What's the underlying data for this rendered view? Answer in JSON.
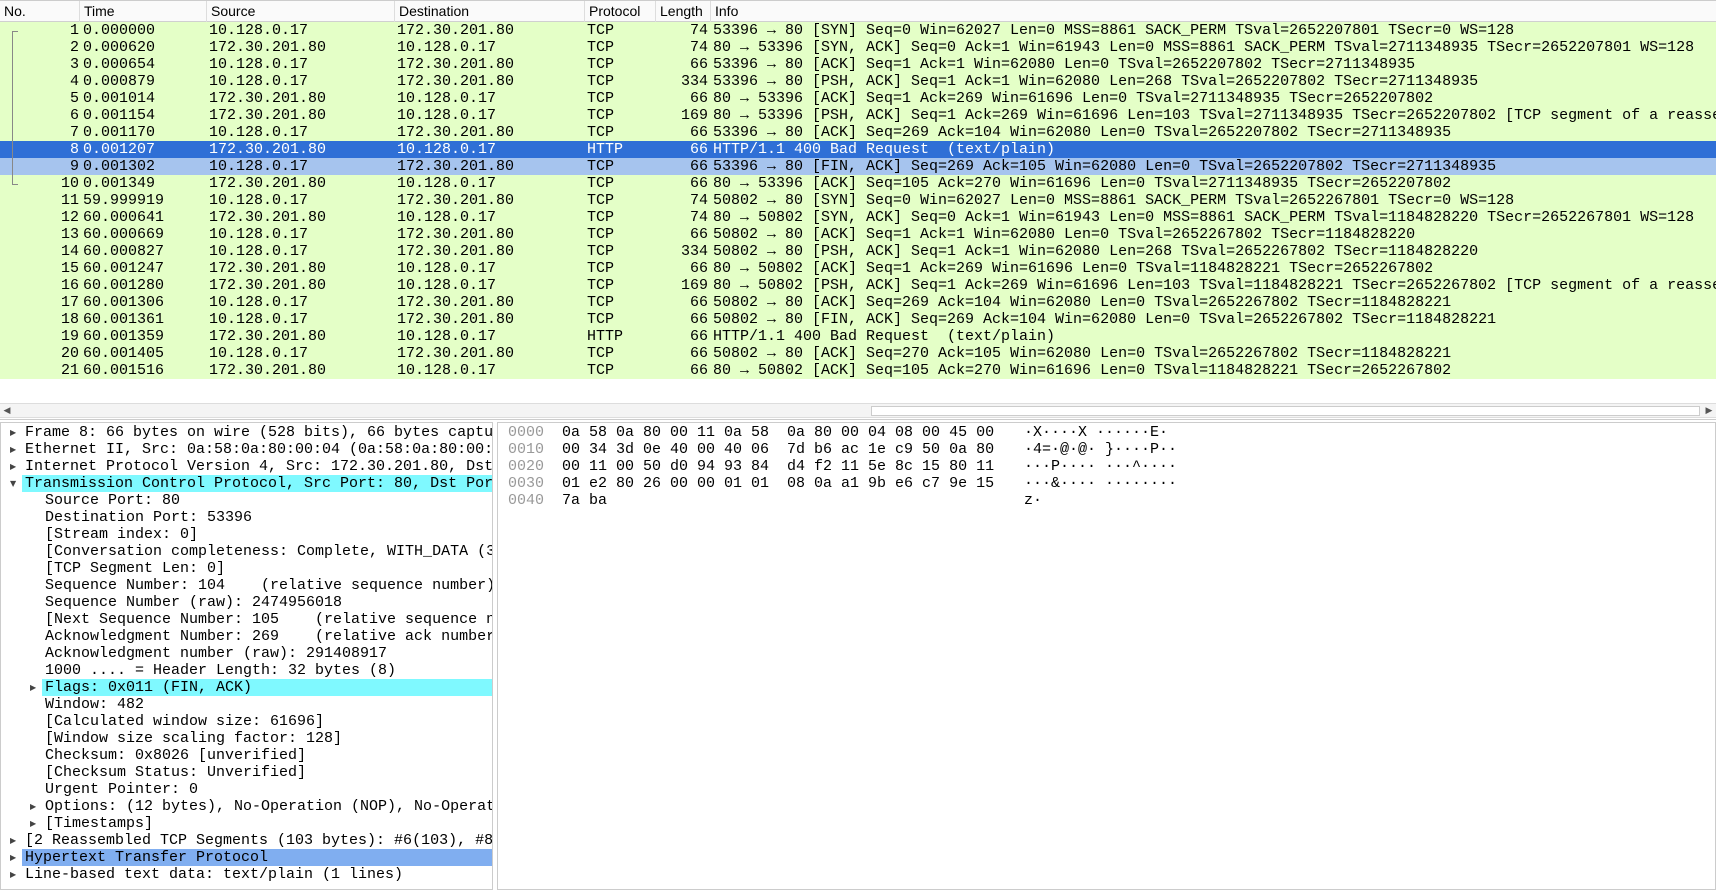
{
  "columns": {
    "no": "No.",
    "time": "Time",
    "source": "Source",
    "destination": "Destination",
    "protocol": "Protocol",
    "length": "Length",
    "info": "Info"
  },
  "packets": [
    {
      "no": "1",
      "time": "0.000000",
      "src": "10.128.0.17",
      "dst": "172.30.201.80",
      "proto": "TCP",
      "len": "74",
      "info": "53396 → 80 [SYN] Seq=0 Win=62027 Len=0 MSS=8861 SACK_PERM TSval=2652207801 TSecr=0 WS=128"
    },
    {
      "no": "2",
      "time": "0.000620",
      "src": "172.30.201.80",
      "dst": "10.128.0.17",
      "proto": "TCP",
      "len": "74",
      "info": "80 → 53396 [SYN, ACK] Seq=0 Ack=1 Win=61943 Len=0 MSS=8861 SACK_PERM TSval=2711348935 TSecr=2652207801 WS=128"
    },
    {
      "no": "3",
      "time": "0.000654",
      "src": "10.128.0.17",
      "dst": "172.30.201.80",
      "proto": "TCP",
      "len": "66",
      "info": "53396 → 80 [ACK] Seq=1 Ack=1 Win=62080 Len=0 TSval=2652207802 TSecr=2711348935"
    },
    {
      "no": "4",
      "time": "0.000879",
      "src": "10.128.0.17",
      "dst": "172.30.201.80",
      "proto": "TCP",
      "len": "334",
      "info": "53396 → 80 [PSH, ACK] Seq=1 Ack=1 Win=62080 Len=268 TSval=2652207802 TSecr=2711348935"
    },
    {
      "no": "5",
      "time": "0.001014",
      "src": "172.30.201.80",
      "dst": "10.128.0.17",
      "proto": "TCP",
      "len": "66",
      "info": "80 → 53396 [ACK] Seq=1 Ack=269 Win=61696 Len=0 TSval=2711348935 TSecr=2652207802"
    },
    {
      "no": "6",
      "time": "0.001154",
      "src": "172.30.201.80",
      "dst": "10.128.0.17",
      "proto": "TCP",
      "len": "169",
      "info": "80 → 53396 [PSH, ACK] Seq=1 Ack=269 Win=61696 Len=103 TSval=2711348935 TSecr=2652207802 [TCP segment of a reasse"
    },
    {
      "no": "7",
      "time": "0.001170",
      "src": "10.128.0.17",
      "dst": "172.30.201.80",
      "proto": "TCP",
      "len": "66",
      "info": "53396 → 80 [ACK] Seq=269 Ack=104 Win=62080 Len=0 TSval=2652207802 TSecr=2711348935"
    },
    {
      "no": "8",
      "time": "0.001207",
      "src": "172.30.201.80",
      "dst": "10.128.0.17",
      "proto": "HTTP",
      "len": "66",
      "info": "HTTP/1.1 400 Bad Request  (text/plain)",
      "state": "selected"
    },
    {
      "no": "9",
      "time": "0.001302",
      "src": "10.128.0.17",
      "dst": "172.30.201.80",
      "proto": "TCP",
      "len": "66",
      "info": "53396 → 80 [FIN, ACK] Seq=269 Ack=105 Win=62080 Len=0 TSval=2652207802 TSecr=2711348935",
      "state": "related"
    },
    {
      "no": "10",
      "time": "0.001349",
      "src": "172.30.201.80",
      "dst": "10.128.0.17",
      "proto": "TCP",
      "len": "66",
      "info": "80 → 53396 [ACK] Seq=105 Ack=270 Win=61696 Len=0 TSval=2711348935 TSecr=2652207802"
    },
    {
      "no": "11",
      "time": "59.999919",
      "src": "10.128.0.17",
      "dst": "172.30.201.80",
      "proto": "TCP",
      "len": "74",
      "info": "50802 → 80 [SYN] Seq=0 Win=62027 Len=0 MSS=8861 SACK_PERM TSval=2652267801 TSecr=0 WS=128"
    },
    {
      "no": "12",
      "time": "60.000641",
      "src": "172.30.201.80",
      "dst": "10.128.0.17",
      "proto": "TCP",
      "len": "74",
      "info": "80 → 50802 [SYN, ACK] Seq=0 Ack=1 Win=61943 Len=0 MSS=8861 SACK_PERM TSval=1184828220 TSecr=2652267801 WS=128"
    },
    {
      "no": "13",
      "time": "60.000669",
      "src": "10.128.0.17",
      "dst": "172.30.201.80",
      "proto": "TCP",
      "len": "66",
      "info": "50802 → 80 [ACK] Seq=1 Ack=1 Win=62080 Len=0 TSval=2652267802 TSecr=1184828220"
    },
    {
      "no": "14",
      "time": "60.000827",
      "src": "10.128.0.17",
      "dst": "172.30.201.80",
      "proto": "TCP",
      "len": "334",
      "info": "50802 → 80 [PSH, ACK] Seq=1 Ack=1 Win=62080 Len=268 TSval=2652267802 TSecr=1184828220"
    },
    {
      "no": "15",
      "time": "60.001247",
      "src": "172.30.201.80",
      "dst": "10.128.0.17",
      "proto": "TCP",
      "len": "66",
      "info": "80 → 50802 [ACK] Seq=1 Ack=269 Win=61696 Len=0 TSval=1184828221 TSecr=2652267802"
    },
    {
      "no": "16",
      "time": "60.001280",
      "src": "172.30.201.80",
      "dst": "10.128.0.17",
      "proto": "TCP",
      "len": "169",
      "info": "80 → 50802 [PSH, ACK] Seq=1 Ack=269 Win=61696 Len=103 TSval=1184828221 TSecr=2652267802 [TCP segment of a reasse"
    },
    {
      "no": "17",
      "time": "60.001306",
      "src": "10.128.0.17",
      "dst": "172.30.201.80",
      "proto": "TCP",
      "len": "66",
      "info": "50802 → 80 [ACK] Seq=269 Ack=104 Win=62080 Len=0 TSval=2652267802 TSecr=1184828221"
    },
    {
      "no": "18",
      "time": "60.001361",
      "src": "10.128.0.17",
      "dst": "172.30.201.80",
      "proto": "TCP",
      "len": "66",
      "info": "50802 → 80 [FIN, ACK] Seq=269 Ack=104 Win=62080 Len=0 TSval=2652267802 TSecr=1184828221"
    },
    {
      "no": "19",
      "time": "60.001359",
      "src": "172.30.201.80",
      "dst": "10.128.0.17",
      "proto": "HTTP",
      "len": "66",
      "info": "HTTP/1.1 400 Bad Request  (text/plain)"
    },
    {
      "no": "20",
      "time": "60.001405",
      "src": "10.128.0.17",
      "dst": "172.30.201.80",
      "proto": "TCP",
      "len": "66",
      "info": "50802 → 80 [ACK] Seq=270 Ack=105 Win=62080 Len=0 TSval=2652267802 TSecr=1184828221"
    },
    {
      "no": "21",
      "time": "60.001516",
      "src": "172.30.201.80",
      "dst": "10.128.0.17",
      "proto": "TCP",
      "len": "66",
      "info": "80 → 50802 [ACK] Seq=105 Ack=270 Win=61696 Len=0 TSval=1184828221 TSecr=2652267802"
    }
  ],
  "details": [
    {
      "text": "Frame 8: 66 bytes on wire (528 bits), 66 bytes captu",
      "level": 0,
      "arrow": "collapsed"
    },
    {
      "text": "Ethernet II, Src: 0a:58:0a:80:00:04 (0a:58:0a:80:00:",
      "level": 0,
      "arrow": "collapsed"
    },
    {
      "text": "Internet Protocol Version 4, Src: 172.30.201.80, Dst",
      "level": 0,
      "arrow": "collapsed"
    },
    {
      "text": "Transmission Control Protocol, Src Port: 80, Dst Por",
      "level": 0,
      "arrow": "expanded",
      "highlight": "cyan"
    },
    {
      "text": "Source Port: 80",
      "level": 1
    },
    {
      "text": "Destination Port: 53396",
      "level": 1
    },
    {
      "text": "[Stream index: 0]",
      "level": 1
    },
    {
      "text": "[Conversation completeness: Complete, WITH_DATA (3",
      "level": 1
    },
    {
      "text": "[TCP Segment Len: 0]",
      "level": 1
    },
    {
      "text": "Sequence Number: 104    (relative sequence number)",
      "level": 1
    },
    {
      "text": "Sequence Number (raw): 2474956018",
      "level": 1
    },
    {
      "text": "[Next Sequence Number: 105    (relative sequence n",
      "level": 1
    },
    {
      "text": "Acknowledgment Number: 269    (relative ack number",
      "level": 1
    },
    {
      "text": "Acknowledgment number (raw): 291408917",
      "level": 1
    },
    {
      "text": "1000 .... = Header Length: 32 bytes (8)",
      "level": 1
    },
    {
      "text": "Flags: 0x011 (FIN, ACK)",
      "level": 1,
      "arrow": "collapsed",
      "highlight": "cyan"
    },
    {
      "text": "Window: 482",
      "level": 1
    },
    {
      "text": "[Calculated window size: 61696]",
      "level": 1
    },
    {
      "text": "[Window size scaling factor: 128]",
      "level": 1
    },
    {
      "text": "Checksum: 0x8026 [unverified]",
      "level": 1
    },
    {
      "text": "[Checksum Status: Unverified]",
      "level": 1
    },
    {
      "text": "Urgent Pointer: 0",
      "level": 1
    },
    {
      "text": "Options: (12 bytes), No-Operation (NOP), No-Operat",
      "level": 1,
      "arrow": "collapsed"
    },
    {
      "text": "[Timestamps]",
      "level": 1,
      "arrow": "collapsed"
    },
    {
      "text": "[2 Reassembled TCP Segments (103 bytes): #6(103), #8",
      "level": 0,
      "arrow": "collapsed"
    },
    {
      "text": "Hypertext Transfer Protocol",
      "level": 0,
      "arrow": "collapsed",
      "highlight": "blue"
    },
    {
      "text": "Line-based text data: text/plain (1 lines)",
      "level": 0,
      "arrow": "collapsed"
    }
  ],
  "bytes": [
    {
      "offset": "0000",
      "hex": "0a 58 0a 80 00 11 0a 58  0a 80 00 04 08 00 45 00",
      "ascii": "·X····X ······E·"
    },
    {
      "offset": "0010",
      "hex": "00 34 3d 0e 40 00 40 06  7d b6 ac 1e c9 50 0a 80",
      "ascii": "·4=·@·@· }····P··"
    },
    {
      "offset": "0020",
      "hex": "00 11 00 50 d0 94 93 84  d4 f2 11 5e 8c 15 80 11",
      "ascii": "···P···· ···^····"
    },
    {
      "offset": "0030",
      "hex": "01 e2 80 26 00 00 01 01  08 0a a1 9b e6 c7 9e 15",
      "ascii": "···&···· ········"
    },
    {
      "offset": "0040",
      "hex": "7a ba",
      "ascii": "z·"
    }
  ],
  "colors": {
    "row_bg": "#e4ffc7",
    "selected": "#2f6fd6",
    "related": "#a6c4ee",
    "field_highlight": "#7ff9ff",
    "protocol_highlight": "#80aef0"
  }
}
